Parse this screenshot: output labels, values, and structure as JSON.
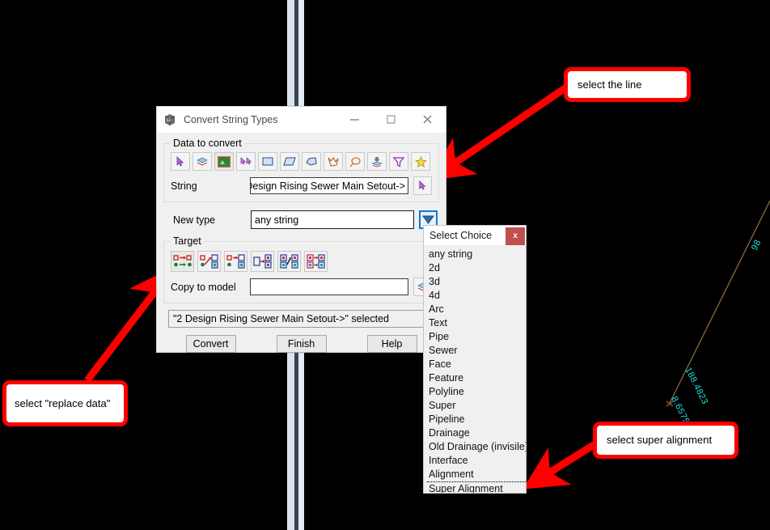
{
  "dialog": {
    "title": "Convert String Types",
    "title_icon": "cube-icon",
    "window_buttons": [
      {
        "name": "minimize-button",
        "glyph": "—"
      },
      {
        "name": "maximize-button",
        "glyph": "□"
      },
      {
        "name": "close-button",
        "glyph": "✕"
      }
    ],
    "data_to_convert": {
      "legend": "Data to convert",
      "tools": [
        {
          "name": "pick-cursor-icon"
        },
        {
          "name": "layers-icon"
        },
        {
          "name": "model-image-icon"
        },
        {
          "name": "multi-pick-icon"
        },
        {
          "name": "rectangle-icon"
        },
        {
          "name": "parallelogram-icon"
        },
        {
          "name": "polygon-icon"
        },
        {
          "name": "irregular-shape-icon"
        },
        {
          "name": "lasso-icon"
        },
        {
          "name": "stack-select-icon"
        },
        {
          "name": "filter-funnel-icon"
        },
        {
          "name": "star-icon"
        }
      ],
      "string_label": "String",
      "string_value": "2 Design Rising Sewer Main Setout->",
      "string_pick_button": "pick-string-button"
    },
    "new_type": {
      "label": "New type",
      "value": "any string",
      "dropdown_button": "dropdown-arrow-button"
    },
    "target": {
      "legend": "Target",
      "options": [
        {
          "name": "target-replace-data-icon",
          "selected": true
        },
        {
          "name": "target-move-data-icon",
          "selected": false
        },
        {
          "name": "target-copy-data-icon",
          "selected": false
        },
        {
          "name": "target-link-data-icon",
          "selected": false
        },
        {
          "name": "target-transfer-data-icon",
          "selected": false
        },
        {
          "name": "target-merge-data-icon",
          "selected": false
        }
      ],
      "copy_to_model_label": "Copy to model",
      "copy_to_model_value": "",
      "copy_to_model_placeholder": "",
      "model_pick_button": "pick-model-button"
    },
    "status": "\"2 Design Rising Sewer Main Setout->\" selected",
    "buttons": [
      {
        "name": "convert-button",
        "label": "Convert"
      },
      {
        "name": "finish-button",
        "label": "Finish"
      },
      {
        "name": "help-button",
        "label": "Help"
      }
    ]
  },
  "select_choice": {
    "title": "Select Choice",
    "close_label": "x",
    "items": [
      "any string",
      "2d",
      "3d",
      "4d",
      "Arc",
      "Text",
      "Pipe",
      "Sewer",
      "Face",
      "Feature",
      "Polyline",
      "Super",
      "Pipeline",
      "Drainage",
      "Old Drainage (invisile)",
      "Interface",
      "Alignment",
      "Super Alignment"
    ],
    "focused_item": "Super Alignment"
  },
  "callouts": [
    {
      "name": "callout-select-the-line",
      "text": "select the line"
    },
    {
      "name": "callout-select-replace-data",
      "text": "select \"replace data\""
    },
    {
      "name": "callout-select-super-alignment",
      "text": "select super alignment"
    }
  ],
  "cad": {
    "labels": [
      {
        "name": "cad-dimension-label-1",
        "text": "98"
      },
      {
        "name": "cad-dimension-label-2",
        "text": "188.4823"
      },
      {
        "name": "cad-dimension-label-3",
        "text": "8.6575"
      }
    ],
    "line_color": "#8a6a3a",
    "label_color": "#19e3e3"
  },
  "colors": {
    "annotation_red": "#ff0000",
    "dialog_bg": "#f0f0f0",
    "accent_blue": "#0a7ad4",
    "close_red": "#c0504d",
    "cad_cyan": "#19e3e3"
  }
}
